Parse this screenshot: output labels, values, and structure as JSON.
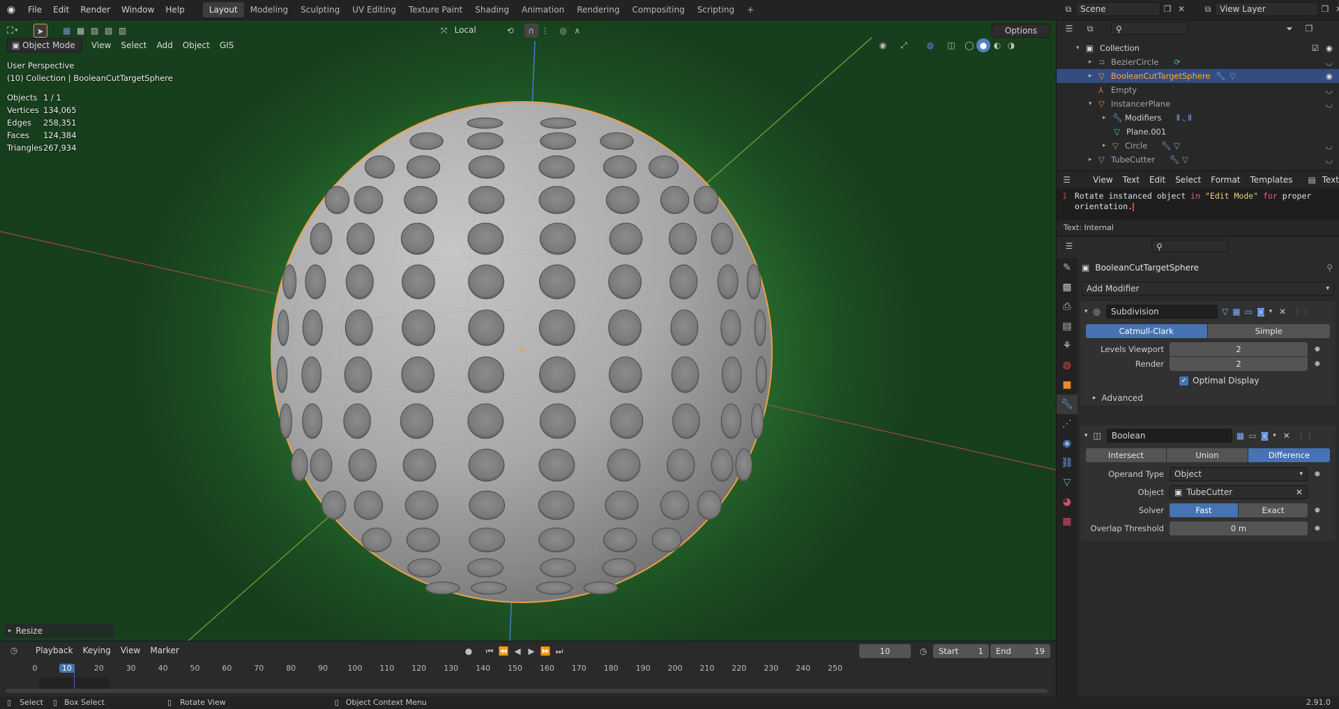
{
  "topbar": {
    "menus": [
      "File",
      "Edit",
      "Render",
      "Window",
      "Help"
    ],
    "workspaces": [
      "Layout",
      "Modeling",
      "Sculpting",
      "UV Editing",
      "Texture Paint",
      "Shading",
      "Animation",
      "Rendering",
      "Compositing",
      "Scripting"
    ],
    "active_workspace": "Layout",
    "add_tab": "+",
    "scene": "Scene",
    "view_layer": "View Layer"
  },
  "viewport_header": {
    "transform_orientation": "Local",
    "options": "Options",
    "mode": "Object Mode",
    "menus": [
      "View",
      "Select",
      "Add",
      "Object",
      "GIS"
    ]
  },
  "viewport": {
    "perspective": "User Perspective",
    "collection_info": "(10) Collection | BooleanCutTargetSphere",
    "stats": [
      {
        "label": "Objects",
        "value": "1 / 1"
      },
      {
        "label": "Vertices",
        "value": "134,065"
      },
      {
        "label": "Edges",
        "value": "258,351"
      },
      {
        "label": "Faces",
        "value": "124,384"
      },
      {
        "label": "Triangles",
        "value": "267,934"
      }
    ],
    "last_operator": "Resize"
  },
  "outliner": {
    "collection": "Collection",
    "items": [
      "BezierCircle",
      "BooleanCutTargetSphere",
      "Empty",
      "InstancerPlane",
      "Modifiers",
      "Plane.001",
      "Circle",
      "TubeCutter"
    ],
    "selected": "BooleanCutTargetSphere"
  },
  "text_editor": {
    "menus": [
      "View",
      "Text",
      "Edit",
      "Select",
      "Format",
      "Templates"
    ],
    "datablock": "Text",
    "line_number": "1",
    "code_a": "Rotate instanced object ",
    "code_in": "in",
    "code_string": "\"Edit Mode\"",
    "code_for": "for",
    "code_b": " proper",
    "code_line2": "orientation.",
    "footer": "Text: Internal"
  },
  "properties": {
    "object_name": "BooleanCutTargetSphere",
    "add_modifier": "Add Modifier",
    "subdivision": {
      "name": "Subdivision",
      "types": [
        "Catmull-Clark",
        "Simple"
      ],
      "active_type": "Catmull-Clark",
      "levels_viewport_label": "Levels Viewport",
      "levels_viewport": "2",
      "render_label": "Render",
      "render": "2",
      "optimal_display": "Optimal Display",
      "advanced": "Advanced"
    },
    "boolean": {
      "name": "Boolean",
      "operations": [
        "Intersect",
        "Union",
        "Difference"
      ],
      "active_operation": "Difference",
      "operand_type_label": "Operand Type",
      "operand_type": "Object",
      "object_label": "Object",
      "object": "TubeCutter",
      "solver_label": "Solver",
      "solvers": [
        "Fast",
        "Exact"
      ],
      "active_solver": "Fast",
      "overlap_label": "Overlap Threshold",
      "overlap": "0 m"
    }
  },
  "timeline": {
    "menus": [
      "Playback",
      "Keying",
      "View",
      "Marker"
    ],
    "current_frame": "10",
    "start_label": "Start",
    "start": "1",
    "end_label": "End",
    "end": "19",
    "ticks": [
      "0",
      "10",
      "20",
      "30",
      "40",
      "50",
      "60",
      "70",
      "80",
      "90",
      "100",
      "110",
      "120",
      "130",
      "140",
      "150",
      "160",
      "170",
      "180",
      "190",
      "200",
      "210",
      "220",
      "230",
      "240",
      "250"
    ]
  },
  "statusbar": {
    "select": "Select",
    "box_select": "Box Select",
    "rotate_view": "Rotate View",
    "context_menu": "Object Context Menu",
    "version": "2.91.0"
  },
  "colors": {
    "accent": "#4772b3",
    "selection_outline": "#ffaa33",
    "object_orange": "#e08a3c",
    "viewport_bg": "#3f8b40"
  }
}
